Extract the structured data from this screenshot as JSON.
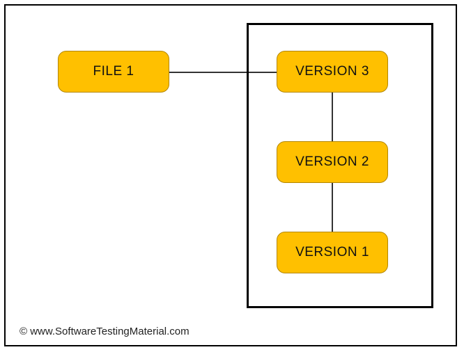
{
  "nodes": {
    "file1": "FILE 1",
    "version3": "VERSION 3",
    "version2": "VERSION 2",
    "version1": "VERSION 1"
  },
  "attribution": "© www.SoftwareTestingMaterial.com",
  "colors": {
    "node_fill": "#ffc000",
    "node_border": "#b38600",
    "frame_border": "#000000"
  }
}
